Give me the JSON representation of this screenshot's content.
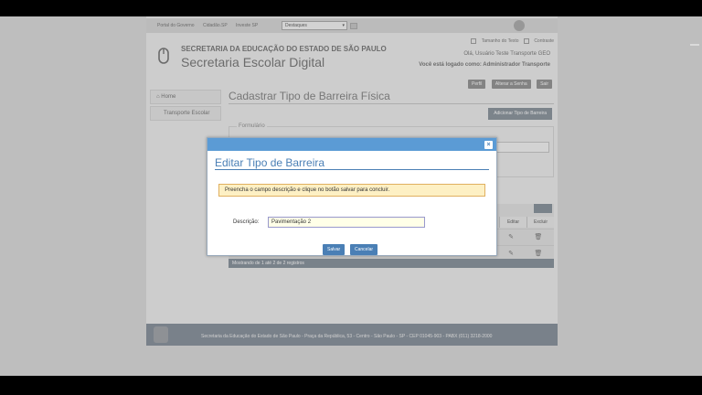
{
  "topbar": {
    "link1": "Portal do Governo",
    "link2": "Cidadão.SP",
    "link3": "Investe SP",
    "select_value": "Destaques"
  },
  "header": {
    "org": "SECRETARIA DA EDUCAÇÃO DO ESTADO DE SÃO PAULO",
    "app": "Secretaria Escolar Digital",
    "tool_text_size": "Tamanho do Texto",
    "tool_contrast": "Contraste",
    "greeting": "Olá, Usuário Teste Transporte GEO",
    "logged_as": "Você está logado como: Administrador Transporte",
    "btn_profile": "Perfil",
    "btn_password": "Alterar a Senha",
    "btn_exit": "Sair"
  },
  "sidebar": {
    "items": [
      {
        "label": "Home"
      },
      {
        "label": "Transporte Escolar"
      }
    ]
  },
  "content": {
    "title": "Cadastrar Tipo de Barreira Física",
    "add_button": "Adicionar Tipo de Barreira",
    "form_legend": "Formulário"
  },
  "grid": {
    "col_edit": "Editar",
    "col_delete": "Excluir",
    "footer": "Mostrando de 1 até 2 de 2 registros"
  },
  "footer": {
    "text": "Secretaria da Educação do Estado de São Paulo - Praça da República, 53 - Centro - São Paulo - SP - CEP 01045-903 - PABX (011) 3218-2000"
  },
  "modal": {
    "title": "Editar Tipo de Barreira",
    "notice": "Preencha o campo descrição e clique no botão salvar para concluir.",
    "desc_label": "Descrição:",
    "desc_value": "Pavimentação 2",
    "save_label": "Salvar",
    "cancel_label": "Cancelar",
    "close_glyph": "×"
  },
  "colors": {
    "modal_bar": "#5b9bd5",
    "notice_bg": "#fdf0c4",
    "button_bg": "#4a7fb5"
  }
}
